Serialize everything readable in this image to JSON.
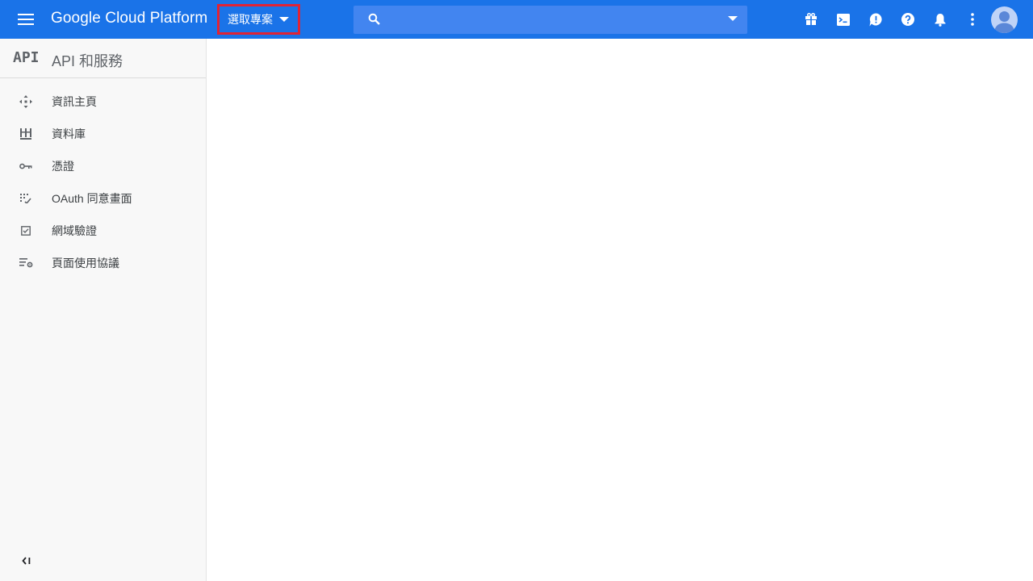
{
  "header": {
    "brand": "Google Cloud Platform",
    "project_picker_label": "選取專案",
    "search_placeholder": "",
    "icons": [
      "menu-icon",
      "gift-icon",
      "cloud-shell-icon",
      "feedback-icon",
      "help-icon",
      "notifications-icon",
      "more-vert-icon",
      "account-avatar"
    ],
    "colors": {
      "bar": "#1a73e8",
      "search": "#4285f0",
      "highlight": "#e02335"
    }
  },
  "sidebar": {
    "logo": "API",
    "title": "API 和服務",
    "items": [
      {
        "label": "資訊主頁",
        "icon": "dashboard-icon"
      },
      {
        "label": "資料庫",
        "icon": "library-icon"
      },
      {
        "label": "憑證",
        "icon": "key-icon"
      },
      {
        "label": "OAuth 同意畫面",
        "icon": "consent-grid-icon"
      },
      {
        "label": "網域驗證",
        "icon": "checkbox-icon"
      },
      {
        "label": "頁面使用協議",
        "icon": "settings-list-icon"
      }
    ],
    "collapse_icon": "collapse-sidebar-icon"
  }
}
